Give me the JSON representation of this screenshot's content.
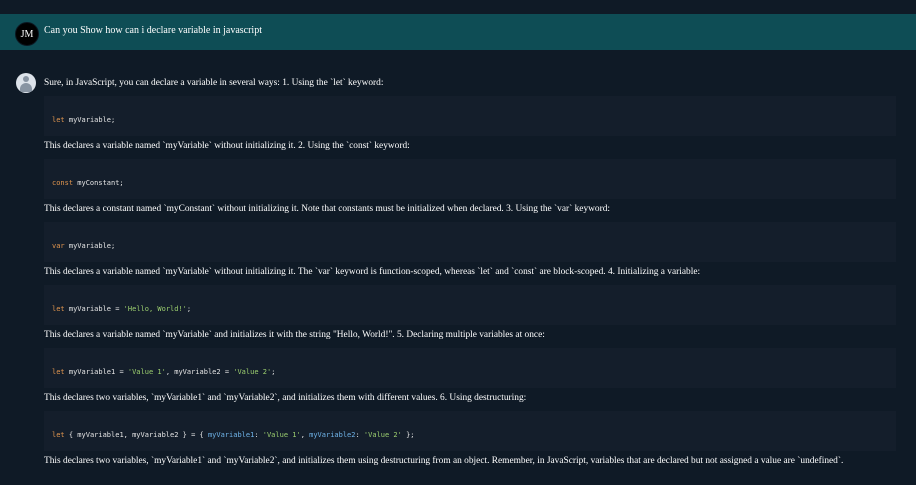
{
  "user_message": {
    "avatar_initials": "JM",
    "text": "Can you Show how can i declare variable in javascript"
  },
  "assistant": {
    "intro": "Sure, in JavaScript, you can declare a variable in several ways: 1. Using the `let` keyword:",
    "code1": {
      "kw": "let",
      "rest": " myVariable;"
    },
    "para1": "This declares a variable named `myVariable` without initializing it. 2. Using the `const` keyword:",
    "code2": {
      "kw": "const",
      "rest": " myConstant;"
    },
    "para2": "This declares a constant named `myConstant` without initializing it. Note that constants must be initialized when declared. 3. Using the `var` keyword:",
    "code3": {
      "kw": "var",
      "rest": " myVariable;"
    },
    "para3": "This declares a variable named `myVariable` without initializing it. The `var` keyword is function-scoped, whereas `let` and `const` are block-scoped. 4. Initializing a variable:",
    "code4": {
      "kw": "let",
      "a": " myVariable = ",
      "s1": "'Hello, World!'",
      "end": ";"
    },
    "para4": "This declares a variable named `myVariable` and initializes it with the string \"Hello, World!\". 5. Declaring multiple variables at once:",
    "code5": {
      "kw": "let",
      "a": " myVariable1 = ",
      "s1": "'Value 1'",
      "b": ", myVariable2 = ",
      "s2": "'Value 2'",
      "end": ";"
    },
    "para5": "This declares two variables, `myVariable1` and `myVariable2`, and initializes them with different values. 6. Using destructuring:",
    "code6": {
      "kw": "let",
      "a": " { myVariable1, myVariable2 } = { ",
      "p1": "myVariable1",
      "c1": ": ",
      "s1": "'Value 1'",
      "b": ", ",
      "p2": "myVariable2",
      "c2": ": ",
      "s2": "'Value 2'",
      "end": " };"
    },
    "para6": "This declares two variables, `myVariable1` and `myVariable2`, and initializes them using destructuring from an object. Remember, in JavaScript, variables that are declared but not assigned a value are `undefined`."
  }
}
